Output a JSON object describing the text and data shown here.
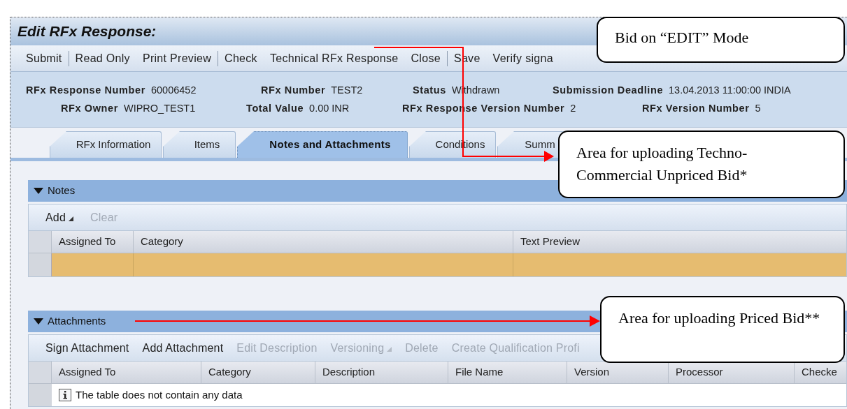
{
  "window": {
    "title": "Edit RFx Response:"
  },
  "toolbar": [
    [
      "Submit"
    ],
    [
      "Read Only",
      "Print Preview"
    ],
    [
      "Check",
      "Technical RFx Response",
      "Close"
    ],
    [
      "Save",
      "Verify signa"
    ]
  ],
  "info_rows": [
    [
      {
        "label": "RFx Response Number",
        "value": "60006452"
      },
      {
        "label": "RFx Number",
        "value": "TEST2"
      },
      {
        "label": "Status",
        "value": "Withdrawn"
      },
      {
        "label": "Submission Deadline",
        "value": "13.04.2013 11:00:00 INDIA"
      }
    ],
    [
      {
        "label": "RFx Owner",
        "value": "WIPRO_TEST1"
      },
      {
        "label": "Total Value",
        "value": "0.00 INR"
      },
      {
        "label": "RFx Response Version Number",
        "value": "2"
      },
      {
        "label": "RFx Version Number",
        "value": "5"
      }
    ]
  ],
  "tabs": [
    {
      "label": "RFx Information",
      "selected": false
    },
    {
      "label": "Items",
      "selected": false
    },
    {
      "label": "Notes and Attachments",
      "selected": true
    },
    {
      "label": "Conditions",
      "selected": false
    },
    {
      "label": "Summ",
      "selected": false
    }
  ],
  "notes": {
    "title": "Notes",
    "expanded": true,
    "actions": [
      {
        "label": "Add",
        "disabled": false,
        "menu": true
      },
      {
        "label": "Clear",
        "disabled": true,
        "menu": false
      }
    ],
    "columns": [
      "Assigned To",
      "Category",
      "Text Preview"
    ],
    "rows": [
      {
        "selected": true
      }
    ]
  },
  "attachments": {
    "title": "Attachments",
    "expanded": true,
    "actions": [
      {
        "label": "Sign Attachment",
        "disabled": false,
        "menu": false
      },
      {
        "label": "Add Attachment",
        "disabled": false,
        "menu": false
      },
      {
        "label": "Edit Description",
        "disabled": true,
        "menu": false
      },
      {
        "label": "Versioning",
        "disabled": true,
        "menu": true
      },
      {
        "label": "Delete",
        "disabled": true,
        "menu": false
      },
      {
        "label": "Create Qualification Profi",
        "disabled": true,
        "menu": false
      }
    ],
    "columns": [
      "Assigned To",
      "Category",
      "Description",
      "File Name",
      "Version",
      "Processor",
      "Checke"
    ],
    "empty_message": "The table does not contain any data"
  },
  "callouts": [
    "Bid on “EDIT” Mode",
    "Area for uploading Techno-Commercial Unpriced Bid*",
    "Area for uploading Priced Bid**"
  ]
}
